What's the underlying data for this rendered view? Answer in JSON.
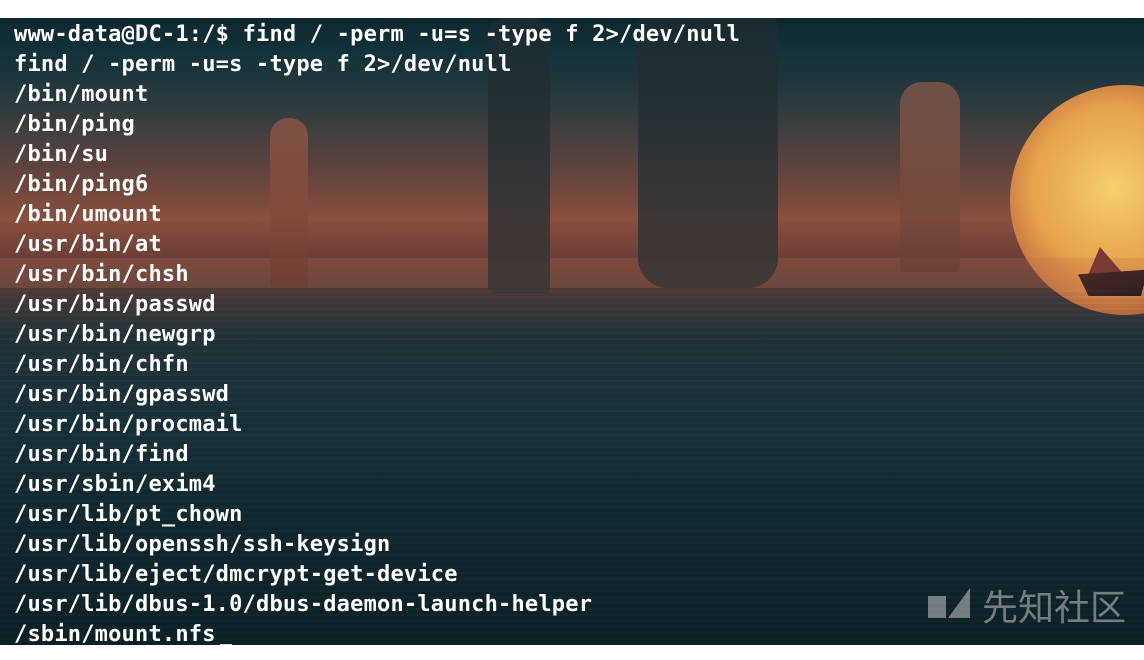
{
  "terminal": {
    "lines": [
      "www-data@DC-1:/$ find / -perm -u=s -type f 2>/dev/null",
      "find / -perm -u=s -type f 2>/dev/null",
      "/bin/mount",
      "/bin/ping",
      "/bin/su",
      "/bin/ping6",
      "/bin/umount",
      "/usr/bin/at",
      "/usr/bin/chsh",
      "/usr/bin/passwd",
      "/usr/bin/newgrp",
      "/usr/bin/chfn",
      "/usr/bin/gpasswd",
      "/usr/bin/procmail",
      "/usr/bin/find",
      "/usr/sbin/exim4",
      "/usr/lib/pt_chown",
      "/usr/lib/openssh/ssh-keysign",
      "/usr/lib/eject/dmcrypt-get-device",
      "/usr/lib/dbus-1.0/dbus-daemon-launch-helper",
      "/sbin/mount.nfs"
    ]
  },
  "watermark": {
    "text": "先知社区",
    "icon": "xianzhi-logo-icon"
  },
  "colors": {
    "text": "#ffffff",
    "background_top": "#0d2229",
    "sun": "#f4d06a"
  }
}
